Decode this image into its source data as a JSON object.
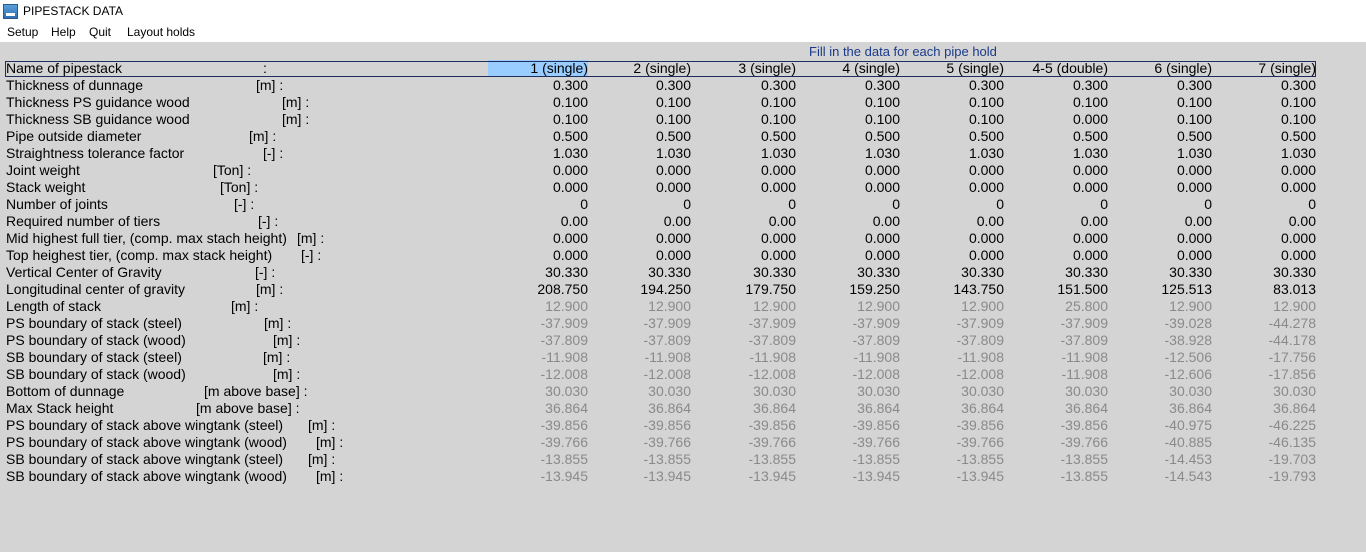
{
  "window": {
    "title": "PIPESTACK DATA"
  },
  "menu": [
    "Setup",
    "Help",
    "Quit",
    "Layout holds"
  ],
  "caption": "Fill in the data for each pipe hold",
  "columns": [
    "1 (single)",
    "2 (single)",
    "3 (single)",
    "4 (single)",
    "5 (single)",
    "4-5 (double)",
    "6 (single)",
    "7 (single)"
  ],
  "rows": [
    {
      "label": "Name of pipestack",
      "unit": ":",
      "values": [
        "1 (single)",
        "2 (single)",
        "3 (single)",
        "4 (single)",
        "5 (single)",
        "4-5 (double)",
        "6 (single)",
        "7 (single)"
      ],
      "grey": false
    },
    {
      "label": "Thickness of dunnage",
      "unit": "[m] :",
      "values": [
        "0.300",
        "0.300",
        "0.300",
        "0.300",
        "0.300",
        "0.300",
        "0.300",
        "0.300"
      ],
      "grey": false
    },
    {
      "label": "Thickness PS guidance wood",
      "unit": "[m] :",
      "values": [
        "0.100",
        "0.100",
        "0.100",
        "0.100",
        "0.100",
        "0.100",
        "0.100",
        "0.100"
      ],
      "grey": false
    },
    {
      "label": "Thickness SB guidance wood",
      "unit": "[m] :",
      "values": [
        "0.100",
        "0.100",
        "0.100",
        "0.100",
        "0.100",
        "0.000",
        "0.100",
        "0.100"
      ],
      "grey": false
    },
    {
      "label": "Pipe outside diameter",
      "unit": "[m] :",
      "values": [
        "0.500",
        "0.500",
        "0.500",
        "0.500",
        "0.500",
        "0.500",
        "0.500",
        "0.500"
      ],
      "grey": false
    },
    {
      "label": "Straightness tolerance factor",
      "unit": "[-] :",
      "values": [
        "1.030",
        "1.030",
        "1.030",
        "1.030",
        "1.030",
        "1.030",
        "1.030",
        "1.030"
      ],
      "grey": false
    },
    {
      "label": "Joint weight",
      "unit": "[Ton] :",
      "values": [
        "0.000",
        "0.000",
        "0.000",
        "0.000",
        "0.000",
        "0.000",
        "0.000",
        "0.000"
      ],
      "grey": false
    },
    {
      "label": "Stack weight",
      "unit": "[Ton] :",
      "values": [
        "0.000",
        "0.000",
        "0.000",
        "0.000",
        "0.000",
        "0.000",
        "0.000",
        "0.000"
      ],
      "grey": false
    },
    {
      "label": "Number of joints",
      "unit": "[-] :",
      "values": [
        "0",
        "0",
        "0",
        "0",
        "0",
        "0",
        "0",
        "0"
      ],
      "grey": false
    },
    {
      "label": "Required number of tiers",
      "unit": "[-] :",
      "values": [
        "0.00",
        "0.00",
        "0.00",
        "0.00",
        "0.00",
        "0.00",
        "0.00",
        "0.00"
      ],
      "grey": false
    },
    {
      "label": "Mid highest full tier, (comp. max stach height)",
      "unit": "[m] :",
      "values": [
        "0.000",
        "0.000",
        "0.000",
        "0.000",
        "0.000",
        "0.000",
        "0.000",
        "0.000"
      ],
      "grey": false
    },
    {
      "label": "Top heighest tier, (comp. max stack height)",
      "unit": "[-] :",
      "values": [
        "0.000",
        "0.000",
        "0.000",
        "0.000",
        "0.000",
        "0.000",
        "0.000",
        "0.000"
      ],
      "grey": false
    },
    {
      "label": "Vertical Center of Gravity",
      "unit": "[-] :",
      "values": [
        "30.330",
        "30.330",
        "30.330",
        "30.330",
        "30.330",
        "30.330",
        "30.330",
        "30.330"
      ],
      "grey": false
    },
    {
      "label": "Longitudinal center of gravity",
      "unit": "[m] :",
      "values": [
        "208.750",
        "194.250",
        "179.750",
        "159.250",
        "143.750",
        "151.500",
        "125.513",
        "83.013"
      ],
      "grey": false
    },
    {
      "label": "Length of stack",
      "unit": "[m] :",
      "values": [
        "12.900",
        "12.900",
        "12.900",
        "12.900",
        "12.900",
        "25.800",
        "12.900",
        "12.900"
      ],
      "grey": true
    },
    {
      "label": "PS boundary of stack (steel)",
      "unit": "[m] :",
      "values": [
        "-37.909",
        "-37.909",
        "-37.909",
        "-37.909",
        "-37.909",
        "-37.909",
        "-39.028",
        "-44.278"
      ],
      "grey": true
    },
    {
      "label": "PS boundary of stack (wood)",
      "unit": "[m] :",
      "values": [
        "-37.809",
        "-37.809",
        "-37.809",
        "-37.809",
        "-37.809",
        "-37.809",
        "-38.928",
        "-44.178"
      ],
      "grey": true
    },
    {
      "label": "SB boundary of stack (steel)",
      "unit": "[m] :",
      "values": [
        "-11.908",
        "-11.908",
        "-11.908",
        "-11.908",
        "-11.908",
        "-11.908",
        "-12.506",
        "-17.756"
      ],
      "grey": true
    },
    {
      "label": "SB boundary of stack (wood)",
      "unit": "[m] :",
      "values": [
        "-12.008",
        "-12.008",
        "-12.008",
        "-12.008",
        "-12.008",
        "-11.908",
        "-12.606",
        "-17.856"
      ],
      "grey": true
    },
    {
      "label": "Bottom of dunnage",
      "unit": "[m above base] :",
      "values": [
        "30.030",
        "30.030",
        "30.030",
        "30.030",
        "30.030",
        "30.030",
        "30.030",
        "30.030"
      ],
      "grey": true
    },
    {
      "label": "Max Stack height",
      "unit": "[m above base] :",
      "values": [
        "36.864",
        "36.864",
        "36.864",
        "36.864",
        "36.864",
        "36.864",
        "36.864",
        "36.864"
      ],
      "grey": true
    },
    {
      "label": "PS boundary of stack above wingtank (steel)",
      "unit": "[m] :",
      "values": [
        "-39.856",
        "-39.856",
        "-39.856",
        "-39.856",
        "-39.856",
        "-39.856",
        "-40.975",
        "-46.225"
      ],
      "grey": true
    },
    {
      "label": "PS boundary of stack above wingtank (wood)",
      "unit": "[m] :",
      "values": [
        "-39.766",
        "-39.766",
        "-39.766",
        "-39.766",
        "-39.766",
        "-39.766",
        "-40.885",
        "-46.135"
      ],
      "grey": true
    },
    {
      "label": "SB boundary of stack above wingtank (steel)",
      "unit": "[m] :",
      "values": [
        "-13.855",
        "-13.855",
        "-13.855",
        "-13.855",
        "-13.855",
        "-13.855",
        "-14.453",
        "-19.703"
      ],
      "grey": true
    },
    {
      "label": "SB boundary of stack above wingtank (wood)",
      "unit": "[m] :",
      "values": [
        "-13.945",
        "-13.945",
        "-13.945",
        "-13.945",
        "-13.945",
        "-13.855",
        "-14.543",
        "-19.793"
      ],
      "grey": true
    }
  ],
  "selected_cell": {
    "row": 0,
    "col": 0
  }
}
